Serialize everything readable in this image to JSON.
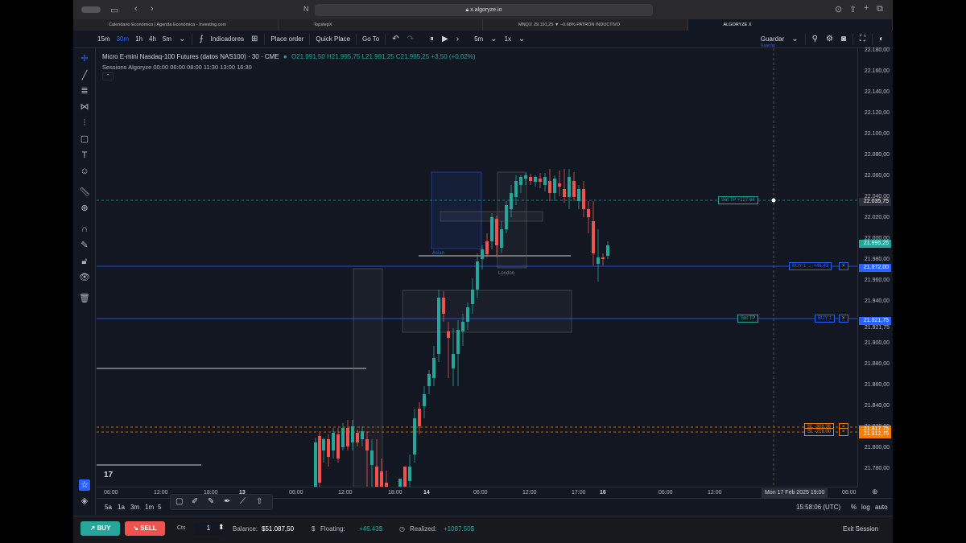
{
  "browser": {
    "url": "x.algoryze.io",
    "tabs": [
      {
        "label": "Calendario Económico | Agenda Económica - Investing.com"
      },
      {
        "label": "TopstepX"
      },
      {
        "label": "MNQ1! 29.191,25 ▼ −0.68% PATRÓN INDUCTIVO"
      },
      {
        "label": "ALGORYZE X"
      }
    ]
  },
  "toolbar": {
    "intervals": [
      "15m",
      "30m",
      "1h",
      "4h",
      "5m"
    ],
    "selected_interval": "30m",
    "indicators_label": "Indicadores",
    "place_order_label": "Place order",
    "quick_place_label": "Quick Place",
    "goto_label": "Go To",
    "replay_interval": "5m",
    "replay_speed": "1x",
    "save_label": "Guardar",
    "save_sub": "Guardar"
  },
  "legend": {
    "symbol": "Micro E-mini Nasdaq-100 Futures (datos NAS100) · 30 · CME",
    "ohlc": "O21.991,50  H21.995,75  L21.991,25  C21.995,25  +3,50 (+0,02%)",
    "sessions": "Sessions Algoryze 00:00 06:00 08:00 11:30 13:00 16:30"
  },
  "price_axis": {
    "ticks": [
      "22.180,00",
      "22.160,00",
      "22.140,00",
      "22.120,00",
      "22.100,00",
      "22.080,00",
      "22.060,00",
      "22.040,00",
      "22.020,00",
      "22.000,00",
      "21.980,00",
      "21.960,00",
      "21.940,00",
      "21.920,00",
      "21.900,00",
      "21.880,00",
      "21.860,00",
      "21.840,00",
      "21.820,00",
      "21.800,00",
      "21.780,00"
    ],
    "tags": [
      {
        "label": "22.035,75",
        "color": "#2a2e39",
        "y": 22035.75
      },
      {
        "label": "21.995,25",
        "color": "#26a69a",
        "y": 21995.25
      },
      {
        "label": "21.972,00",
        "color": "#2962ff",
        "y": 21972.0
      },
      {
        "label": "21.921,75",
        "color": "#2962ff",
        "y": 21921.75
      },
      {
        "label": "21.817,75",
        "color": "#f57c00",
        "y": 21817.75
      },
      {
        "label": "21.812,75",
        "color": "#f57c00",
        "y": 21812.75
      }
    ],
    "plain_label": "21.921,75"
  },
  "orders": {
    "tp_label": "Set TP +127.64",
    "buy1_label": "BUY 1  → +46.43",
    "set_tp_label": "Set TP",
    "buy1b_label": "BUY 1",
    "sl1_label": "SL  -308.36",
    "sl2_label": "SL  -218.00",
    "close_x": "×"
  },
  "chart_labels": {
    "asian": "Asian",
    "london": "London"
  },
  "time_axis": {
    "labels": [
      "06:00",
      "12:00",
      "18:00",
      "13",
      "06:00",
      "12:00",
      "18:00",
      "14",
      "06:00",
      "12:00",
      "17:00",
      "16",
      "06:00",
      "12:00",
      "06:00"
    ],
    "crosshair": "Mon 17 Feb 2025   19:00"
  },
  "bottom": {
    "ranges": [
      "5a",
      "1a",
      "3m",
      "1m",
      "5"
    ],
    "clock": "15:58:06 (UTC)",
    "percent": "%",
    "log": "log",
    "auto": "auto"
  },
  "trade": {
    "buy_label": "BUY",
    "sell_label": "SELL",
    "cts_label": "Cts",
    "qty": "1",
    "balance_label": "Balance:",
    "balance": "$51.087,50",
    "floating_label": "Floating:",
    "floating": "+46.43$",
    "realized_label": "Realized:",
    "realized": "+1087.50$",
    "exit_label": "Exit Session"
  }
}
